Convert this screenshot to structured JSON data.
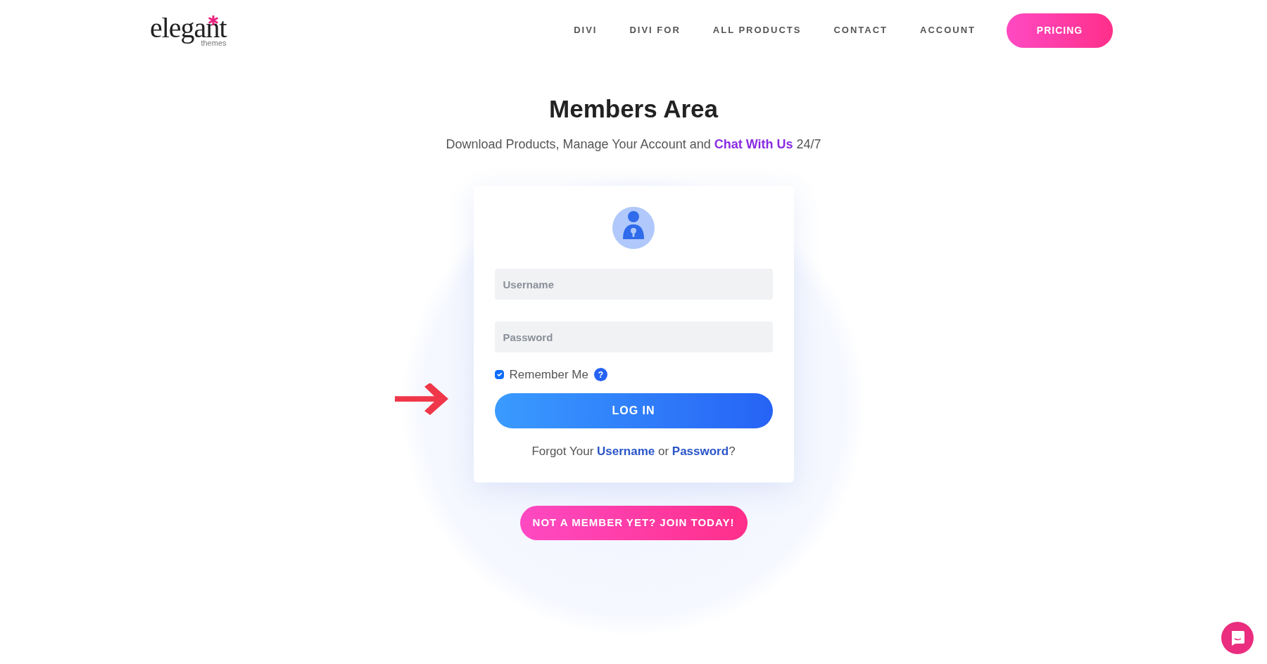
{
  "logo": {
    "name": "elegant",
    "sub": "themes"
  },
  "nav": [
    {
      "label": "DIVI"
    },
    {
      "label": "DIVI FOR"
    },
    {
      "label": "ALL PRODUCTS"
    },
    {
      "label": "CONTACT"
    },
    {
      "label": "ACCOUNT"
    }
  ],
  "pricing_button": "PRICING",
  "title": "Members Area",
  "subtitle": {
    "before": "Download Products, Manage Your Account and",
    "link": "Chat With Us",
    "after": "24/7"
  },
  "login": {
    "username_placeholder": "Username",
    "password_placeholder": "Password",
    "remember": {
      "label": "Remember Me",
      "checked": true,
      "help": "?"
    },
    "submit": "LOG IN",
    "forgot": {
      "before": "Forgot Your",
      "link1": "Username",
      "middle": "or",
      "link2": "Password",
      "after": "?"
    }
  },
  "join_button": "NOT A MEMBER YET? JOIN TODAY!"
}
